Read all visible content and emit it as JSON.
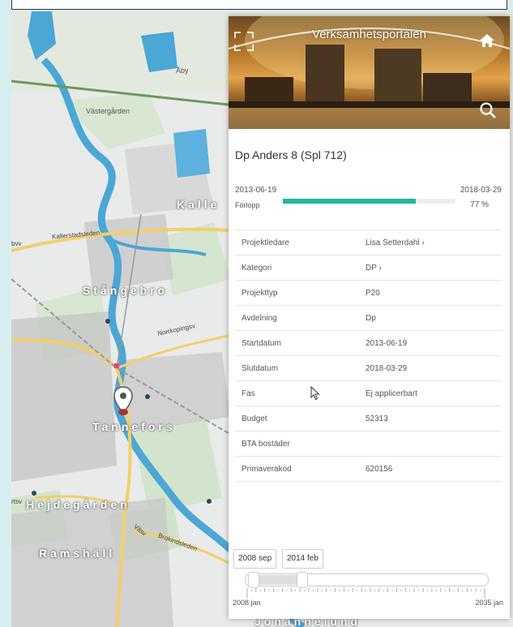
{
  "map": {
    "places": {
      "aby": "Åby",
      "vastergarden": "Västergården",
      "kallerstad": "Kalle",
      "stangebro": "Stångebro",
      "tannefors": "Tannefors",
      "hejdegarden": "Hejdegården",
      "ramshall": "Ramshäll",
      "johannelund": "Johannelund"
    },
    "roads": {
      "kallerstadsleden": "Kallerstadsleden",
      "norrkopingsv": "Norrkopingsv",
      "brokindsleden": "Brokindsleden",
      "byv": "bvv",
      "isv": "rtsv",
      "vasv": "Väsv"
    },
    "colors": {
      "land": "#e9eaea",
      "water": "#4aa7d6",
      "green": "#cfe3c8",
      "major_road": "#f3cf6a"
    }
  },
  "panel": {
    "title": "Verksamhetsportalen",
    "home_icon": "home-icon",
    "search_icon": "search-icon",
    "expand_icon": "expand-icon",
    "project_name": "Dp Anders 8 (Spl 712)",
    "start_date": "2013-06-19",
    "end_date": "2018-03-29",
    "progress_label": "Förlopp",
    "progress_value": 0.77,
    "progress_text": "77 %",
    "accent": "#1fb89a",
    "rows": [
      {
        "label": "Projektledare",
        "value": "Lisa Setterdahl ›",
        "link": true
      },
      {
        "label": "Kategori",
        "value": "DP ›",
        "link": true
      },
      {
        "label": "Projekttyp",
        "value": "P20",
        "link": false
      },
      {
        "label": "Avdelning",
        "value": "Dp",
        "link": false
      },
      {
        "label": "Startdatum",
        "value": "2013-06-19",
        "link": false
      },
      {
        "label": "Slutdatum",
        "value": "2018-03-29",
        "link": false
      },
      {
        "label": "Fas",
        "value": "Ej applicerbart",
        "link": false
      },
      {
        "label": "Budget",
        "value": "52313",
        "link": false
      },
      {
        "label": "BTA bostäder",
        "value": "",
        "link": false
      },
      {
        "label": "Primaverakod",
        "value": "620156",
        "link": false
      }
    ]
  },
  "timeline": {
    "from_button": "2008 sep",
    "to_button": "2014 feb",
    "min_label": "2008 jan",
    "max_label": "2035 jan",
    "range_start_fraction": 0.03,
    "range_end_fraction": 0.23
  }
}
